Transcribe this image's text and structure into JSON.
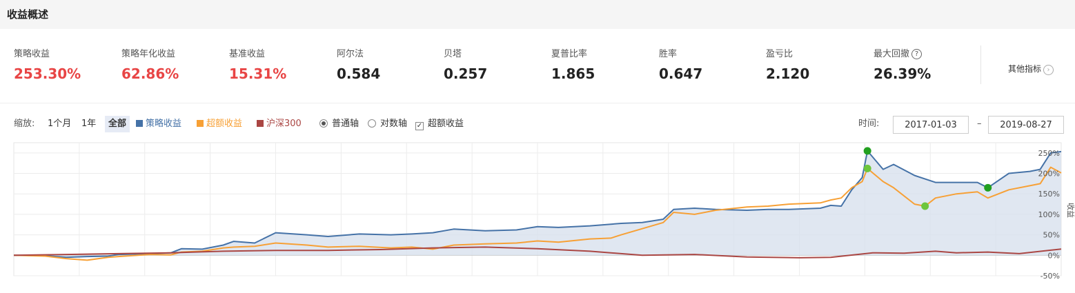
{
  "header": {
    "title": "收益概述"
  },
  "metrics": [
    {
      "label": "策略收益",
      "value": "253.30%",
      "color": "red"
    },
    {
      "label": "策略年化收益",
      "value": "62.86%",
      "color": "red"
    },
    {
      "label": "基准收益",
      "value": "15.31%",
      "color": "red"
    },
    {
      "label": "阿尔法",
      "value": "0.584",
      "color": "dark"
    },
    {
      "label": "贝塔",
      "value": "0.257",
      "color": "dark"
    },
    {
      "label": "夏普比率",
      "value": "1.865",
      "color": "dark"
    },
    {
      "label": "胜率",
      "value": "0.647",
      "color": "dark"
    },
    {
      "label": "盈亏比",
      "value": "2.120",
      "color": "dark"
    },
    {
      "label": "最大回撤",
      "value": "26.39%",
      "color": "dark",
      "help_icon": "question-circle-icon"
    }
  ],
  "other_metrics": {
    "label": "其他指标",
    "icon": "chevron-right-circle-icon"
  },
  "toolbar": {
    "zoom_label": "缩放:",
    "zoom_options": [
      "1个月",
      "1年",
      "全部"
    ],
    "zoom_selected": "全部",
    "legend": [
      {
        "label": "策略收益",
        "color": "#4572a7"
      },
      {
        "label": "超额收益",
        "color": "#f7a035"
      },
      {
        "label": "沪深300",
        "color": "#aa4643"
      }
    ],
    "axis_options": [
      {
        "label": "普通轴",
        "selected": true
      },
      {
        "label": "对数轴",
        "selected": false
      }
    ],
    "excess_checkbox": {
      "label": "超额收益",
      "checked": true
    },
    "time_label": "时间:",
    "date_from": "2017-01-03",
    "date_sep": "–",
    "date_to": "2019-08-27"
  },
  "chart_data": {
    "type": "line",
    "x_range": [
      "2017-01-03",
      "2019-08-27"
    ],
    "ylim": [
      -50,
      275
    ],
    "y_ticks": [
      "250%",
      "200%",
      "150%",
      "100%",
      "50%",
      "0%",
      "-50%"
    ],
    "y_tick_values": [
      250,
      200,
      150,
      100,
      50,
      0,
      -50
    ],
    "ylabel": "收益",
    "grid": true,
    "series": [
      {
        "name": "策略收益",
        "color": "#4572a7",
        "fill": "#d8e1ee",
        "values": [
          [
            0,
            0
          ],
          [
            0.03,
            -1
          ],
          [
            0.05,
            -5
          ],
          [
            0.07,
            -3
          ],
          [
            0.09,
            -2
          ],
          [
            0.1,
            2
          ],
          [
            0.13,
            4
          ],
          [
            0.15,
            6
          ],
          [
            0.16,
            16
          ],
          [
            0.18,
            15
          ],
          [
            0.2,
            25
          ],
          [
            0.21,
            34
          ],
          [
            0.23,
            30
          ],
          [
            0.25,
            55
          ],
          [
            0.28,
            50
          ],
          [
            0.3,
            46
          ],
          [
            0.33,
            52
          ],
          [
            0.36,
            50
          ],
          [
            0.38,
            52
          ],
          [
            0.4,
            55
          ],
          [
            0.42,
            64
          ],
          [
            0.45,
            60
          ],
          [
            0.48,
            62
          ],
          [
            0.5,
            70
          ],
          [
            0.52,
            68
          ],
          [
            0.55,
            72
          ],
          [
            0.57,
            76
          ],
          [
            0.58,
            78
          ],
          [
            0.6,
            80
          ],
          [
            0.62,
            88
          ],
          [
            0.63,
            112
          ],
          [
            0.65,
            115
          ],
          [
            0.67,
            112
          ],
          [
            0.7,
            110
          ],
          [
            0.72,
            112
          ],
          [
            0.74,
            112
          ],
          [
            0.77,
            115
          ],
          [
            0.78,
            122
          ],
          [
            0.79,
            120
          ],
          [
            0.8,
            160
          ],
          [
            0.81,
            190
          ],
          [
            0.815,
            255
          ],
          [
            0.83,
            210
          ],
          [
            0.84,
            222
          ],
          [
            0.86,
            195
          ],
          [
            0.88,
            178
          ],
          [
            0.9,
            178
          ],
          [
            0.92,
            178
          ],
          [
            0.93,
            165
          ],
          [
            0.95,
            200
          ],
          [
            0.97,
            205
          ],
          [
            0.98,
            210
          ],
          [
            0.99,
            250
          ],
          [
            1.0,
            253.3
          ]
        ]
      },
      {
        "name": "超额收益",
        "color": "#f7a035",
        "values": [
          [
            0,
            0
          ],
          [
            0.03,
            -2
          ],
          [
            0.05,
            -8
          ],
          [
            0.07,
            -12
          ],
          [
            0.09,
            -5
          ],
          [
            0.1,
            -3
          ],
          [
            0.13,
            2
          ],
          [
            0.15,
            1
          ],
          [
            0.16,
            8
          ],
          [
            0.18,
            10
          ],
          [
            0.2,
            18
          ],
          [
            0.21,
            20
          ],
          [
            0.23,
            22
          ],
          [
            0.25,
            30
          ],
          [
            0.28,
            25
          ],
          [
            0.3,
            20
          ],
          [
            0.33,
            22
          ],
          [
            0.36,
            18
          ],
          [
            0.38,
            20
          ],
          [
            0.4,
            15
          ],
          [
            0.42,
            25
          ],
          [
            0.45,
            28
          ],
          [
            0.48,
            30
          ],
          [
            0.5,
            35
          ],
          [
            0.52,
            32
          ],
          [
            0.55,
            40
          ],
          [
            0.57,
            42
          ],
          [
            0.58,
            50
          ],
          [
            0.6,
            65
          ],
          [
            0.62,
            80
          ],
          [
            0.63,
            105
          ],
          [
            0.65,
            100
          ],
          [
            0.67,
            110
          ],
          [
            0.7,
            118
          ],
          [
            0.72,
            120
          ],
          [
            0.74,
            125
          ],
          [
            0.77,
            128
          ],
          [
            0.78,
            135
          ],
          [
            0.79,
            140
          ],
          [
            0.8,
            165
          ],
          [
            0.81,
            180
          ],
          [
            0.815,
            212
          ],
          [
            0.83,
            180
          ],
          [
            0.84,
            165
          ],
          [
            0.86,
            125
          ],
          [
            0.87,
            120
          ],
          [
            0.88,
            140
          ],
          [
            0.9,
            150
          ],
          [
            0.92,
            155
          ],
          [
            0.93,
            140
          ],
          [
            0.95,
            160
          ],
          [
            0.97,
            170
          ],
          [
            0.98,
            175
          ],
          [
            0.99,
            215
          ],
          [
            1.0,
            201
          ]
        ]
      },
      {
        "name": "沪深300",
        "color": "#aa4643",
        "values": [
          [
            0,
            0
          ],
          [
            0.05,
            2
          ],
          [
            0.1,
            4
          ],
          [
            0.15,
            6
          ],
          [
            0.2,
            10
          ],
          [
            0.25,
            12
          ],
          [
            0.3,
            12
          ],
          [
            0.35,
            14
          ],
          [
            0.4,
            18
          ],
          [
            0.45,
            20
          ],
          [
            0.5,
            16
          ],
          [
            0.55,
            10
          ],
          [
            0.6,
            0
          ],
          [
            0.65,
            2
          ],
          [
            0.7,
            -4
          ],
          [
            0.75,
            -6
          ],
          [
            0.78,
            -5
          ],
          [
            0.82,
            6
          ],
          [
            0.85,
            5
          ],
          [
            0.88,
            10
          ],
          [
            0.9,
            6
          ],
          [
            0.93,
            8
          ],
          [
            0.96,
            4
          ],
          [
            1.0,
            15.31
          ]
        ]
      }
    ],
    "markers": [
      {
        "series": "策略收益",
        "x": 0.815,
        "y": 255,
        "color": "#22a020"
      },
      {
        "series": "策略收益",
        "x": 0.93,
        "y": 165,
        "color": "#22a020"
      },
      {
        "series": "超额收益",
        "x": 0.815,
        "y": 212,
        "color": "#6dc63c"
      },
      {
        "series": "超额收益",
        "x": 0.87,
        "y": 120,
        "color": "#6dc63c"
      }
    ]
  }
}
